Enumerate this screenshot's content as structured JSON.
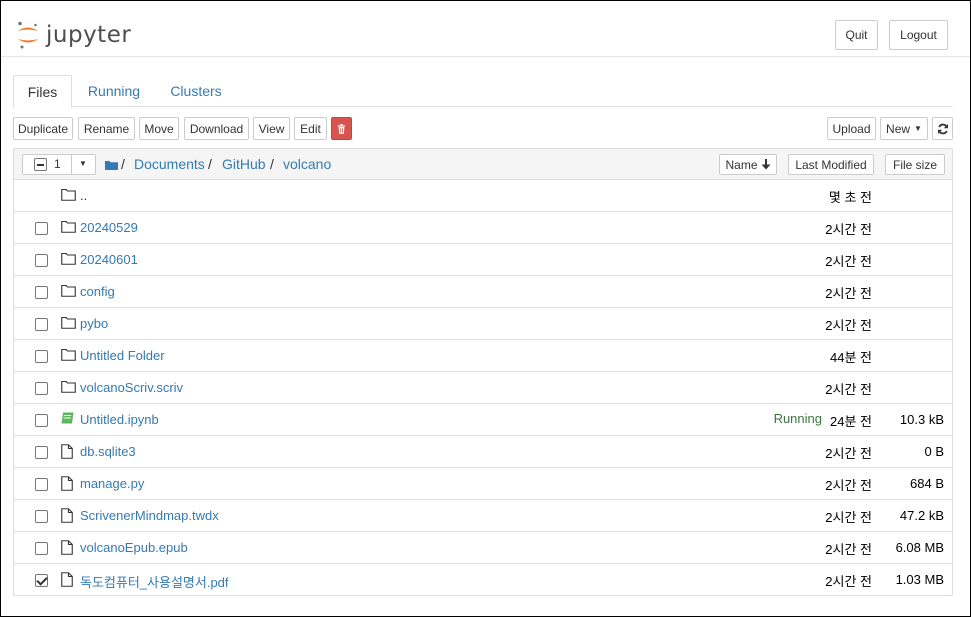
{
  "header": {
    "logo_text": "jupyter",
    "quit_label": "Quit",
    "logout_label": "Logout",
    "logo_colors": {
      "orange": "#F37726",
      "gray": "#767677"
    }
  },
  "tabs": [
    {
      "label": "Files",
      "active": true
    },
    {
      "label": "Running",
      "active": false
    },
    {
      "label": "Clusters",
      "active": false
    }
  ],
  "toolbar": {
    "duplicate_label": "Duplicate",
    "rename_label": "Rename",
    "move_label": "Move",
    "download_label": "Download",
    "view_label": "View",
    "edit_label": "Edit",
    "delete_icon": "trash-icon",
    "upload_label": "Upload",
    "new_label": "New",
    "refresh_icon": "refresh-icon"
  },
  "list_header": {
    "selected_count": "1",
    "breadcrumb": [
      "Documents",
      "GitHub",
      "volcano"
    ],
    "breadcrumb_separator": "/",
    "sort_name_label": "Name",
    "sort_modified_label": "Last Modified",
    "sort_size_label": "File size"
  },
  "rows": [
    {
      "name": "..",
      "type": "parent",
      "modified": "몇 초 전",
      "size": "",
      "status": "",
      "checked": false
    },
    {
      "name": "20240529",
      "type": "folder",
      "modified": "2시간 전",
      "size": "",
      "status": "",
      "checked": false
    },
    {
      "name": "20240601",
      "type": "folder",
      "modified": "2시간 전",
      "size": "",
      "status": "",
      "checked": false
    },
    {
      "name": "config",
      "type": "folder",
      "modified": "2시간 전",
      "size": "",
      "status": "",
      "checked": false
    },
    {
      "name": "pybo",
      "type": "folder",
      "modified": "2시간 전",
      "size": "",
      "status": "",
      "checked": false
    },
    {
      "name": "Untitled Folder",
      "type": "folder",
      "modified": "44분 전",
      "size": "",
      "status": "",
      "checked": false
    },
    {
      "name": "volcanoScriv.scriv",
      "type": "folder",
      "modified": "2시간 전",
      "size": "",
      "status": "",
      "checked": false
    },
    {
      "name": "Untitled.ipynb",
      "type": "notebook",
      "modified": "24분 전",
      "size": "10.3 kB",
      "status": "Running",
      "checked": false
    },
    {
      "name": "db.sqlite3",
      "type": "file",
      "modified": "2시간 전",
      "size": "0 B",
      "status": "",
      "checked": false
    },
    {
      "name": "manage.py",
      "type": "file",
      "modified": "2시간 전",
      "size": "684 B",
      "status": "",
      "checked": false
    },
    {
      "name": "ScrivenerMindmap.twdx",
      "type": "file",
      "modified": "2시간 전",
      "size": "47.2 kB",
      "status": "",
      "checked": false
    },
    {
      "name": "volcanoEpub.epub",
      "type": "file",
      "modified": "2시간 전",
      "size": "6.08 MB",
      "status": "",
      "checked": false
    },
    {
      "name": "독도컴퓨터_사용설명서.pdf",
      "type": "file",
      "modified": "2시간 전",
      "size": "1.03 MB",
      "status": "",
      "checked": true
    }
  ],
  "colors": {
    "link": "#337ab7",
    "running": "#3c763d",
    "danger": "#d9534f",
    "notebook_icon": "#5cb85c"
  }
}
